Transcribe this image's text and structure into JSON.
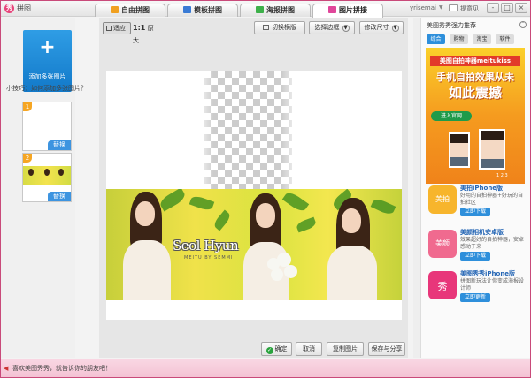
{
  "window": {
    "title": "拼图",
    "user_name": "yrisemai",
    "feedback": "提意见",
    "minimize": "-",
    "maximize": "□",
    "close": "×"
  },
  "tabs": [
    {
      "label": "自由拼图",
      "active": false,
      "icon_color": "#f0a020"
    },
    {
      "label": "模板拼图",
      "active": false,
      "icon_color": "#3a7bd5"
    },
    {
      "label": "海报拼图",
      "active": false,
      "icon_color": "#3db04a"
    },
    {
      "label": "图片拼接",
      "active": true,
      "icon_color": "#e0469a"
    }
  ],
  "left_panel": {
    "add_button_plus": "+",
    "add_button_label": "添加多张图片",
    "tip": "小技巧：如何添加多张图片？",
    "thumbnails": [
      {
        "number": "1",
        "swap_label": "替换"
      },
      {
        "number": "2",
        "swap_label": "替换"
      }
    ]
  },
  "toolbar": {
    "fit_label": "适应",
    "original_prefix": "1:1",
    "original_label": "原大",
    "switch_label": "切换横版",
    "border_label": "选择边框",
    "size_label": "修改尺寸"
  },
  "canvas": {
    "logo_text": "Seol Hyun",
    "logo_sub": "MEITU BY SEMMI"
  },
  "bottom_buttons": {
    "ok": "确定",
    "cancel": "取消",
    "copy": "复制图片",
    "save": "保存与分享"
  },
  "right_panel": {
    "title": "美图秀秀强力推荐",
    "collapse": "˄",
    "tabs": [
      {
        "label": "综合",
        "active": true
      },
      {
        "label": "购物",
        "active": false
      },
      {
        "label": "淘宝",
        "active": false
      },
      {
        "label": "软件",
        "active": false
      }
    ],
    "ad": {
      "top": "美图自拍神器meitukiss",
      "line1": "手机自拍效果从未",
      "line2": "如此震撼",
      "button": "进入官网",
      "pages": "1 2 3"
    },
    "apps": [
      {
        "name": "美拍iPhone版",
        "desc": "好用的自拍神器+好玩的自拍社区",
        "button": "立即下载",
        "icon_color": "#f7b52c",
        "icon_text": "美拍"
      },
      {
        "name": "美颜相机安卓版",
        "desc": "效果超好的自拍神器，安卓感动于来",
        "button": "立即下载",
        "icon_color": "#f06a8f",
        "icon_text": "美颜"
      },
      {
        "name": "美图秀秀iPhone版",
        "desc": "拼图新玩法让你变成海报设计师",
        "button": "立即更新",
        "icon_color": "#e8367a",
        "icon_text": "秀"
      }
    ]
  },
  "status_bar": {
    "text": "喜欢美图秀秀，就告诉你的朋友吧！"
  }
}
